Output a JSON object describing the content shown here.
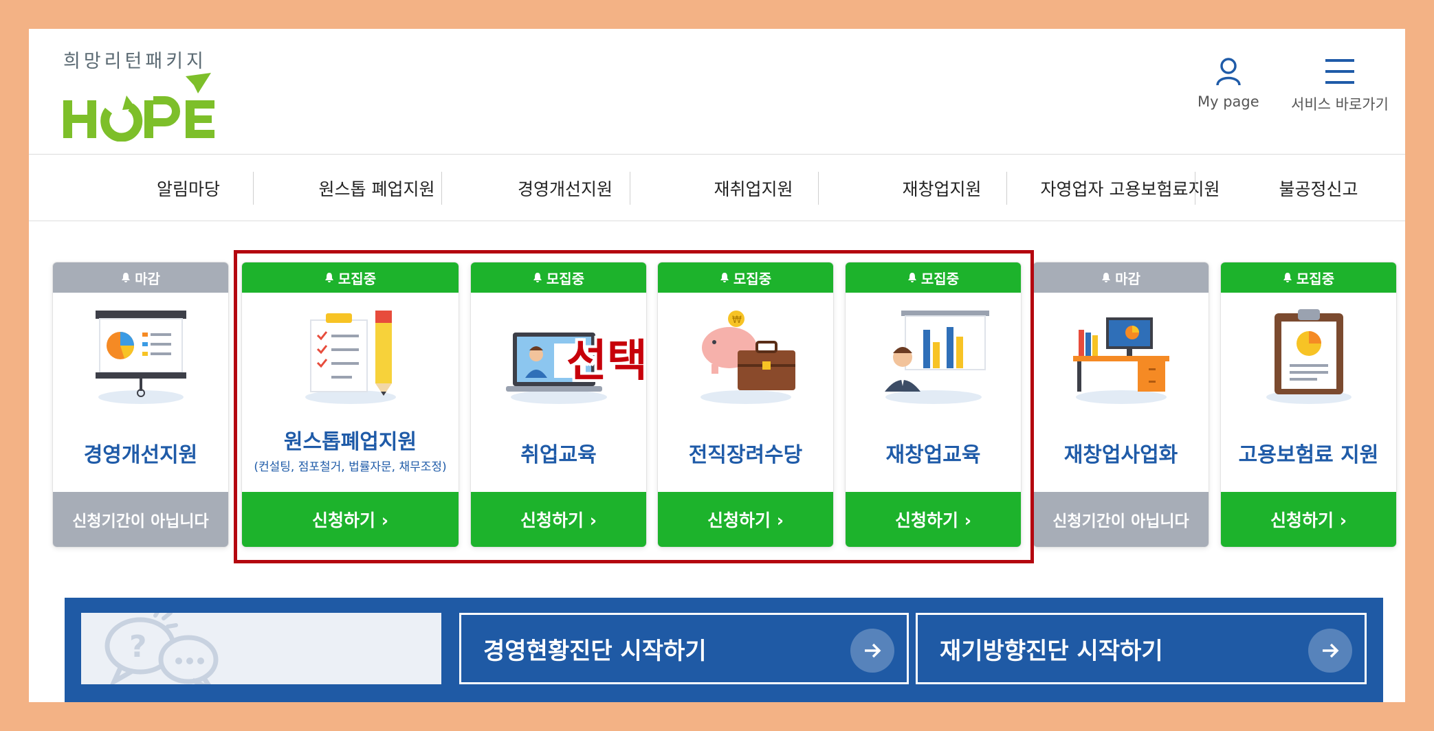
{
  "header": {
    "logo_sub": "희망리턴패키지",
    "logo_main": "HOPE",
    "mypage_label": "My page",
    "service_label": "서비스 바로가기"
  },
  "nav": [
    "알림마당",
    "원스톱 폐업지원",
    "경영개선지원",
    "재취업지원",
    "재창업지원",
    "자영업자 고용보험료지원",
    "불공정신고"
  ],
  "cards": [
    {
      "status": "마감",
      "title": "경영개선지원",
      "subtitle": "",
      "button": "신청기간이 아닙니다",
      "active": false
    },
    {
      "status": "모집중",
      "title": "원스톱폐업지원",
      "subtitle": "(컨설팅, 점포철거, 법률자문, 채무조정)",
      "button": "신청하기 ›",
      "active": true
    },
    {
      "status": "모집중",
      "title": "취업교육",
      "subtitle": "",
      "button": "신청하기 ›",
      "active": true
    },
    {
      "status": "모집중",
      "title": "전직장려수당",
      "subtitle": "",
      "button": "신청하기 ›",
      "active": true
    },
    {
      "status": "모집중",
      "title": "재창업교육",
      "subtitle": "",
      "button": "신청하기 ›",
      "active": true
    },
    {
      "status": "마감",
      "title": "재창업사업화",
      "subtitle": "",
      "button": "신청기간이 아닙니다",
      "active": false
    },
    {
      "status": "모집중",
      "title": "고용보험료 지원",
      "subtitle": "",
      "button": "신청하기 ›",
      "active": true
    }
  ],
  "annotation": {
    "select_label": "선택"
  },
  "diagnosis": {
    "btn1": "경영현황진단 시작하기",
    "btn2": "재기방향진단 시작하기"
  },
  "colors": {
    "brand_green": "#7dbf2a",
    "active_green": "#1db32c",
    "inactive_grey": "#a7adb7",
    "title_blue": "#1f5ba8",
    "highlight_red": "#b4060f",
    "diag_blue": "#1f5aa5"
  }
}
